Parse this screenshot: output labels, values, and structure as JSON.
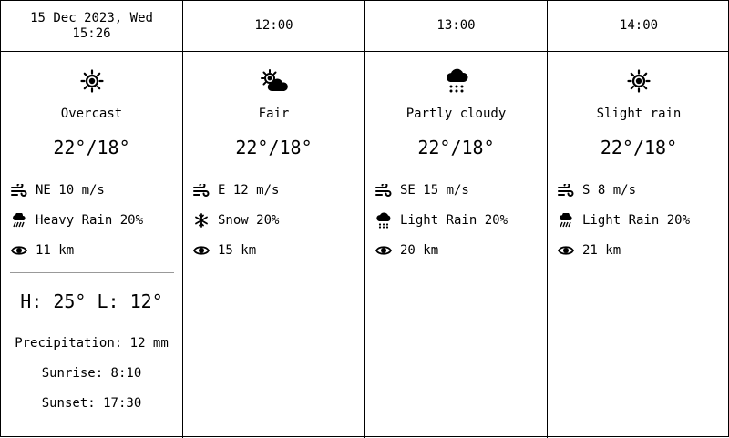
{
  "columns": [
    {
      "header_line1": "15 Dec 2023, Wed",
      "header_line2": "15:26",
      "icon": "sun-icon",
      "condition": "Overcast",
      "temp": "22°/18°",
      "wind": "NE 10 m/s",
      "precip_icon": "rain-icon",
      "precip": "Heavy Rain 20%",
      "visibility": "11 km"
    },
    {
      "header_line1": "12:00",
      "icon": "sun-cloud-icon",
      "condition": "Fair",
      "temp": "22°/18°",
      "wind": "E 12 m/s",
      "precip_icon": "snowflake-icon",
      "precip": "Snow 20%",
      "visibility": "15 km"
    },
    {
      "header_line1": "13:00",
      "icon": "cloud-rain-icon",
      "condition": "Partly cloudy",
      "temp": "22°/18°",
      "wind": "SE 15 m/s",
      "precip_icon": "cloud-rain-small-icon",
      "precip": "Light Rain 20%",
      "visibility": "20 km"
    },
    {
      "header_line1": "14:00",
      "icon": "sun-icon",
      "condition": "Slight rain",
      "temp": "22°/18°",
      "wind": "S 8 m/s",
      "precip_icon": "rain-icon",
      "precip": "Light Rain 20%",
      "visibility": "21 km"
    }
  ],
  "summary": {
    "hilo": "H: 25° L: 12°",
    "precipitation": "Precipitation: 12 mm",
    "sunrise": "Sunrise: 8:10",
    "sunset": "Sunset: 17:30"
  }
}
